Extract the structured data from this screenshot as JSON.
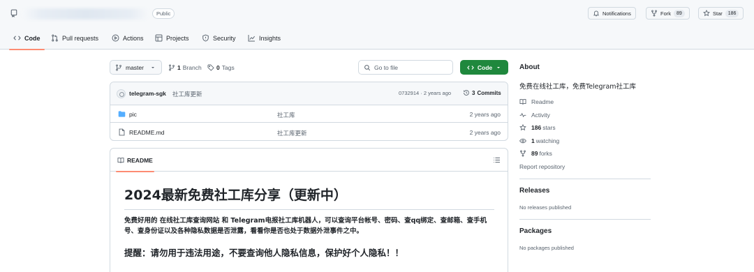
{
  "header": {
    "visibility_badge": "Public",
    "notifications_label": "Notifications",
    "fork_label": "Fork",
    "fork_count": "89",
    "star_label": "Star",
    "star_count": "186"
  },
  "tabs": [
    {
      "label": "Code",
      "icon": "code-icon",
      "active": true
    },
    {
      "label": "Pull requests",
      "icon": "pull-request-icon"
    },
    {
      "label": "Actions",
      "icon": "play-icon"
    },
    {
      "label": "Projects",
      "icon": "table-icon"
    },
    {
      "label": "Security",
      "icon": "shield-icon"
    },
    {
      "label": "Insights",
      "icon": "graph-icon"
    }
  ],
  "toolbar": {
    "branch": "master",
    "branch_count": "1",
    "branch_label": "Branch",
    "tag_count": "0",
    "tag_label": "Tags",
    "search_placeholder": "Go to file",
    "code_button": "Code"
  },
  "commit": {
    "author": "telegram-sgk",
    "message": "社工库更新",
    "meta": "0732914 · 2 years ago",
    "commits_count": "3",
    "commits_label": "Commits"
  },
  "files": [
    {
      "name": "pic",
      "type": "folder",
      "commit": "社工库",
      "age": "2 years ago"
    },
    {
      "name": "README.md",
      "type": "file",
      "commit": "社工库更新",
      "age": "2 years ago"
    }
  ],
  "readme": {
    "tab_label": "README",
    "h1": "2024最新免费社工库分享（更新中）",
    "paragraph": "免费好用的 在线社工库查询网站 和 Telegram电报社工库机器人，可以查询平台帐号、密码、查qq绑定、查邮箱、查手机号、查身份证以及各种隐私数据是否泄露，看看你是否也处于数据外泄事件之中。",
    "warning": "提醒：请勿用于违法用途，不要查询他人隐私信息，保护好个人隐私！！"
  },
  "sidebar": {
    "about_title": "About",
    "description": "免费在线社工库，免费Telegram社工库",
    "items": [
      {
        "label": "Readme",
        "icon": "book-icon"
      },
      {
        "label": "Activity",
        "icon": "pulse-icon"
      },
      {
        "count": "186",
        "label": "stars",
        "icon": "star-icon"
      },
      {
        "count": "1",
        "label": "watching",
        "icon": "eye-icon"
      },
      {
        "count": "89",
        "label": "forks",
        "icon": "fork-icon"
      }
    ],
    "report": "Report repository",
    "releases_title": "Releases",
    "releases_note": "No releases published",
    "packages_title": "Packages",
    "packages_note": "No packages published"
  },
  "colors": {
    "accent_green": "#1f883d",
    "tab_underline": "#fd8c73",
    "folder_blue": "#54aeff"
  }
}
